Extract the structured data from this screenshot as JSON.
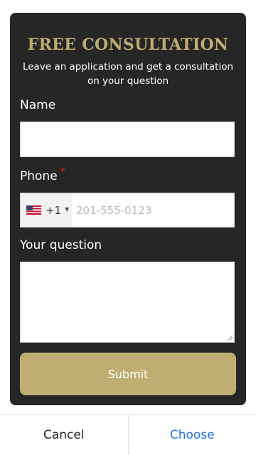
{
  "form": {
    "title": "FREE CONSULTATION",
    "subtitle": "Leave an application and get a consultation on your question",
    "name_label": "Name",
    "name_value": "",
    "phone_label": "Phone",
    "phone_required_mark": "*",
    "phone_country_flag": "us-flag-icon",
    "phone_dial_code": "+1",
    "phone_placeholder": "201-555-0123",
    "question_label": "Your question",
    "question_value": "",
    "submit_label": "Submit"
  },
  "dialog": {
    "cancel_label": "Cancel",
    "choose_label": "Choose"
  },
  "colors": {
    "accent_gold": "#bfac6e",
    "card_bg": "#262626",
    "link_blue": "#1a73e8",
    "required_red": "#e02020"
  }
}
